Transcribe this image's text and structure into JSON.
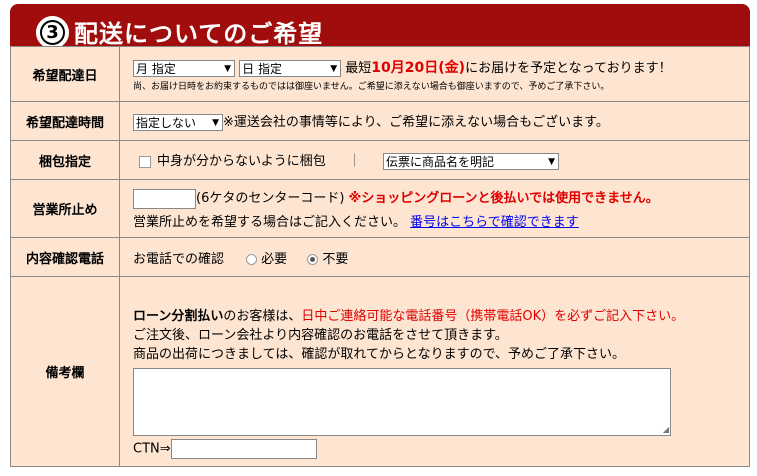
{
  "header": {
    "number": "3",
    "title": "配送についてのご希望"
  },
  "rows": {
    "delivery_date": {
      "label": "希望配達日",
      "month_select": "月 指定",
      "day_select": "日 指定",
      "earliest_prefix": "最短",
      "earliest_date": "10月20日(金)",
      "earliest_suffix": "にお届けを予定となっております！",
      "note": "尚、お届け日時をお約束するものではは御座いません。ご希望に添えない場合も御座いますので、予めご了承下さい。"
    },
    "delivery_time": {
      "label": "希望配達時間",
      "select": "指定しない",
      "note": "※運送会社の事情等により、ご希望に添えない場合もございます。"
    },
    "packing": {
      "label": "梱包指定",
      "checkbox_label": "中身が分からないように梱包",
      "separator": "｜",
      "select": "伝票に商品名を明記"
    },
    "office_stop": {
      "label": "営業所止め",
      "code_hint": "(6ケタのセンターコード)",
      "warning": "※ショッピングローンと後払いでは使用できません。",
      "note": "営業所止めを希望する場合はご記入ください。",
      "link": "番号はこちらで確認できます"
    },
    "confirm_call": {
      "label": "内容確認電話",
      "text": "お電話での確認",
      "option_need": "必要",
      "option_no_need": "不要",
      "selected": "不要"
    },
    "remarks": {
      "label": "備考欄",
      "line1_bold": "ローン分割払い",
      "line1_mid": "のお客様は、",
      "line1_red": "日中ご連絡可能な電話番号（携帯電話OK）を必ずご記入下さい。",
      "line2": "ご注文後、ローン会社より内容確認のお電話をさせて頂きます。",
      "line3": "商品の出荷につきましては、確認が取れてからとなりますので、予めご了承下さい。",
      "ctn_label": "CTN⇒"
    }
  },
  "colors": {
    "header_bg": "#a10c0c",
    "row_bg": "#fde5d2",
    "warning": "#e00000",
    "link": "#0000ee"
  }
}
